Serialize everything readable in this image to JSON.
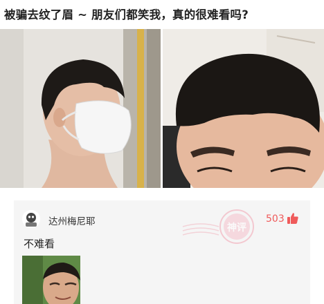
{
  "post": {
    "title": "被骗去纹了眉 ~ 朋友们都笑我，真的很难看吗?"
  },
  "comment": {
    "username": "达州梅尼耶",
    "like_count": "503",
    "text": "不难看",
    "stamp_text": "神评"
  },
  "colors": {
    "accent": "#ef5a5a",
    "card_background": "#f5f5f5",
    "title_text": "#222222"
  },
  "icons": {
    "like": "thumbs-up-icon"
  }
}
